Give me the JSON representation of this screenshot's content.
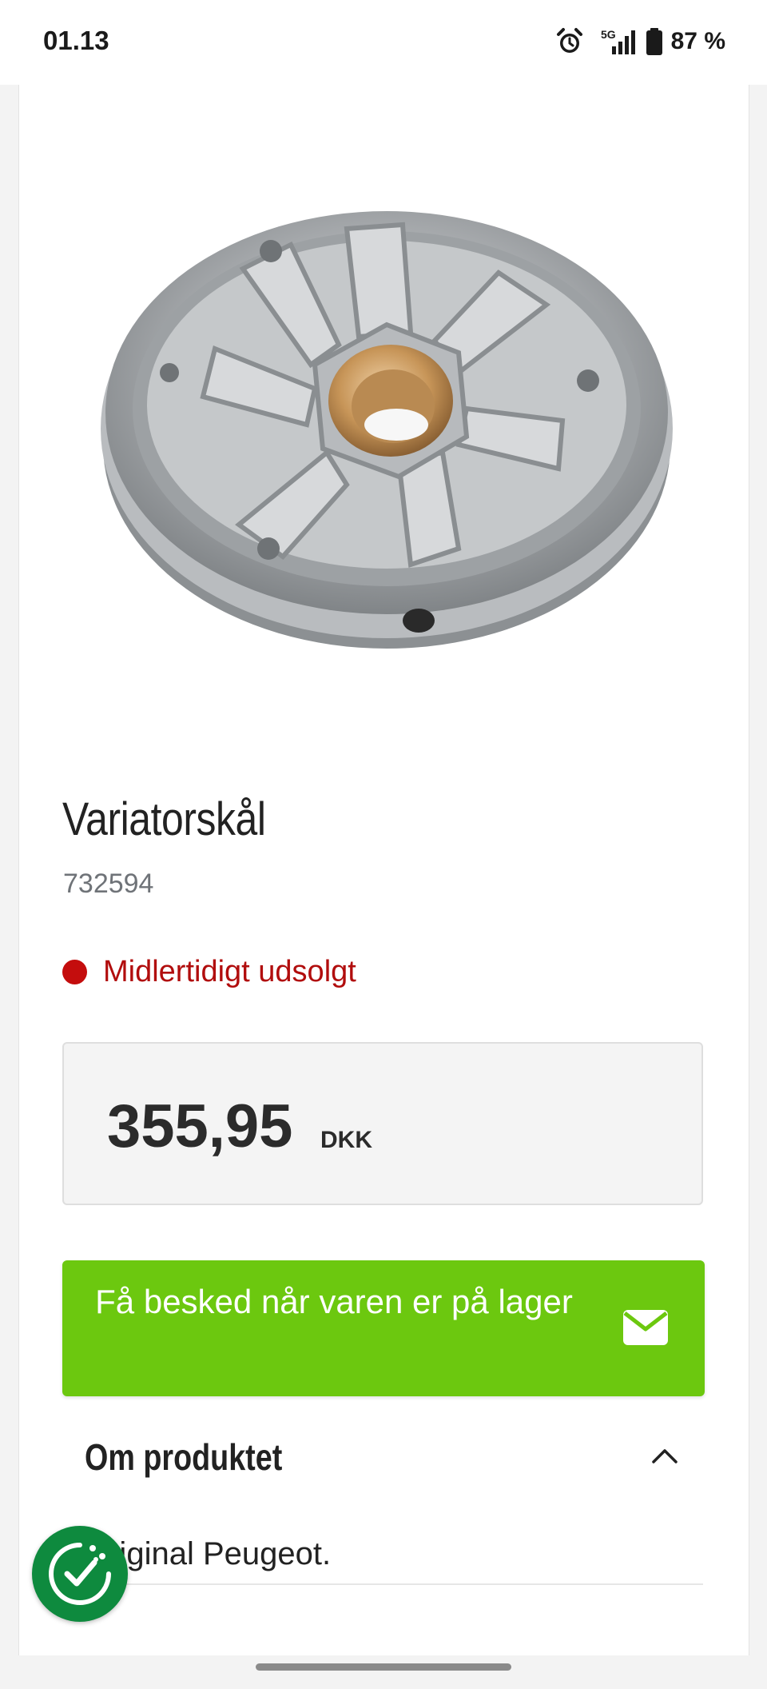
{
  "status_bar": {
    "time": "01.13",
    "network": "5G",
    "battery": "87 %"
  },
  "product": {
    "title": "Variatorskål",
    "sku": "732594",
    "stock_status": "Midlertidigt udsolgt",
    "price": "355,95",
    "currency": "DKK",
    "notify_button_label": "Få besked når varen er på lager"
  },
  "about": {
    "heading": "Om produktet",
    "description": "Original Peugeot."
  },
  "colors": {
    "accent_green": "#6cc80f",
    "out_of_stock_red": "#c40d0d",
    "cookie_green": "#0e8a3e"
  },
  "icons": [
    "alarm-icon",
    "signal-icon",
    "battery-icon",
    "mail-icon",
    "chevron-up-icon",
    "cookie-consent-icon"
  ]
}
